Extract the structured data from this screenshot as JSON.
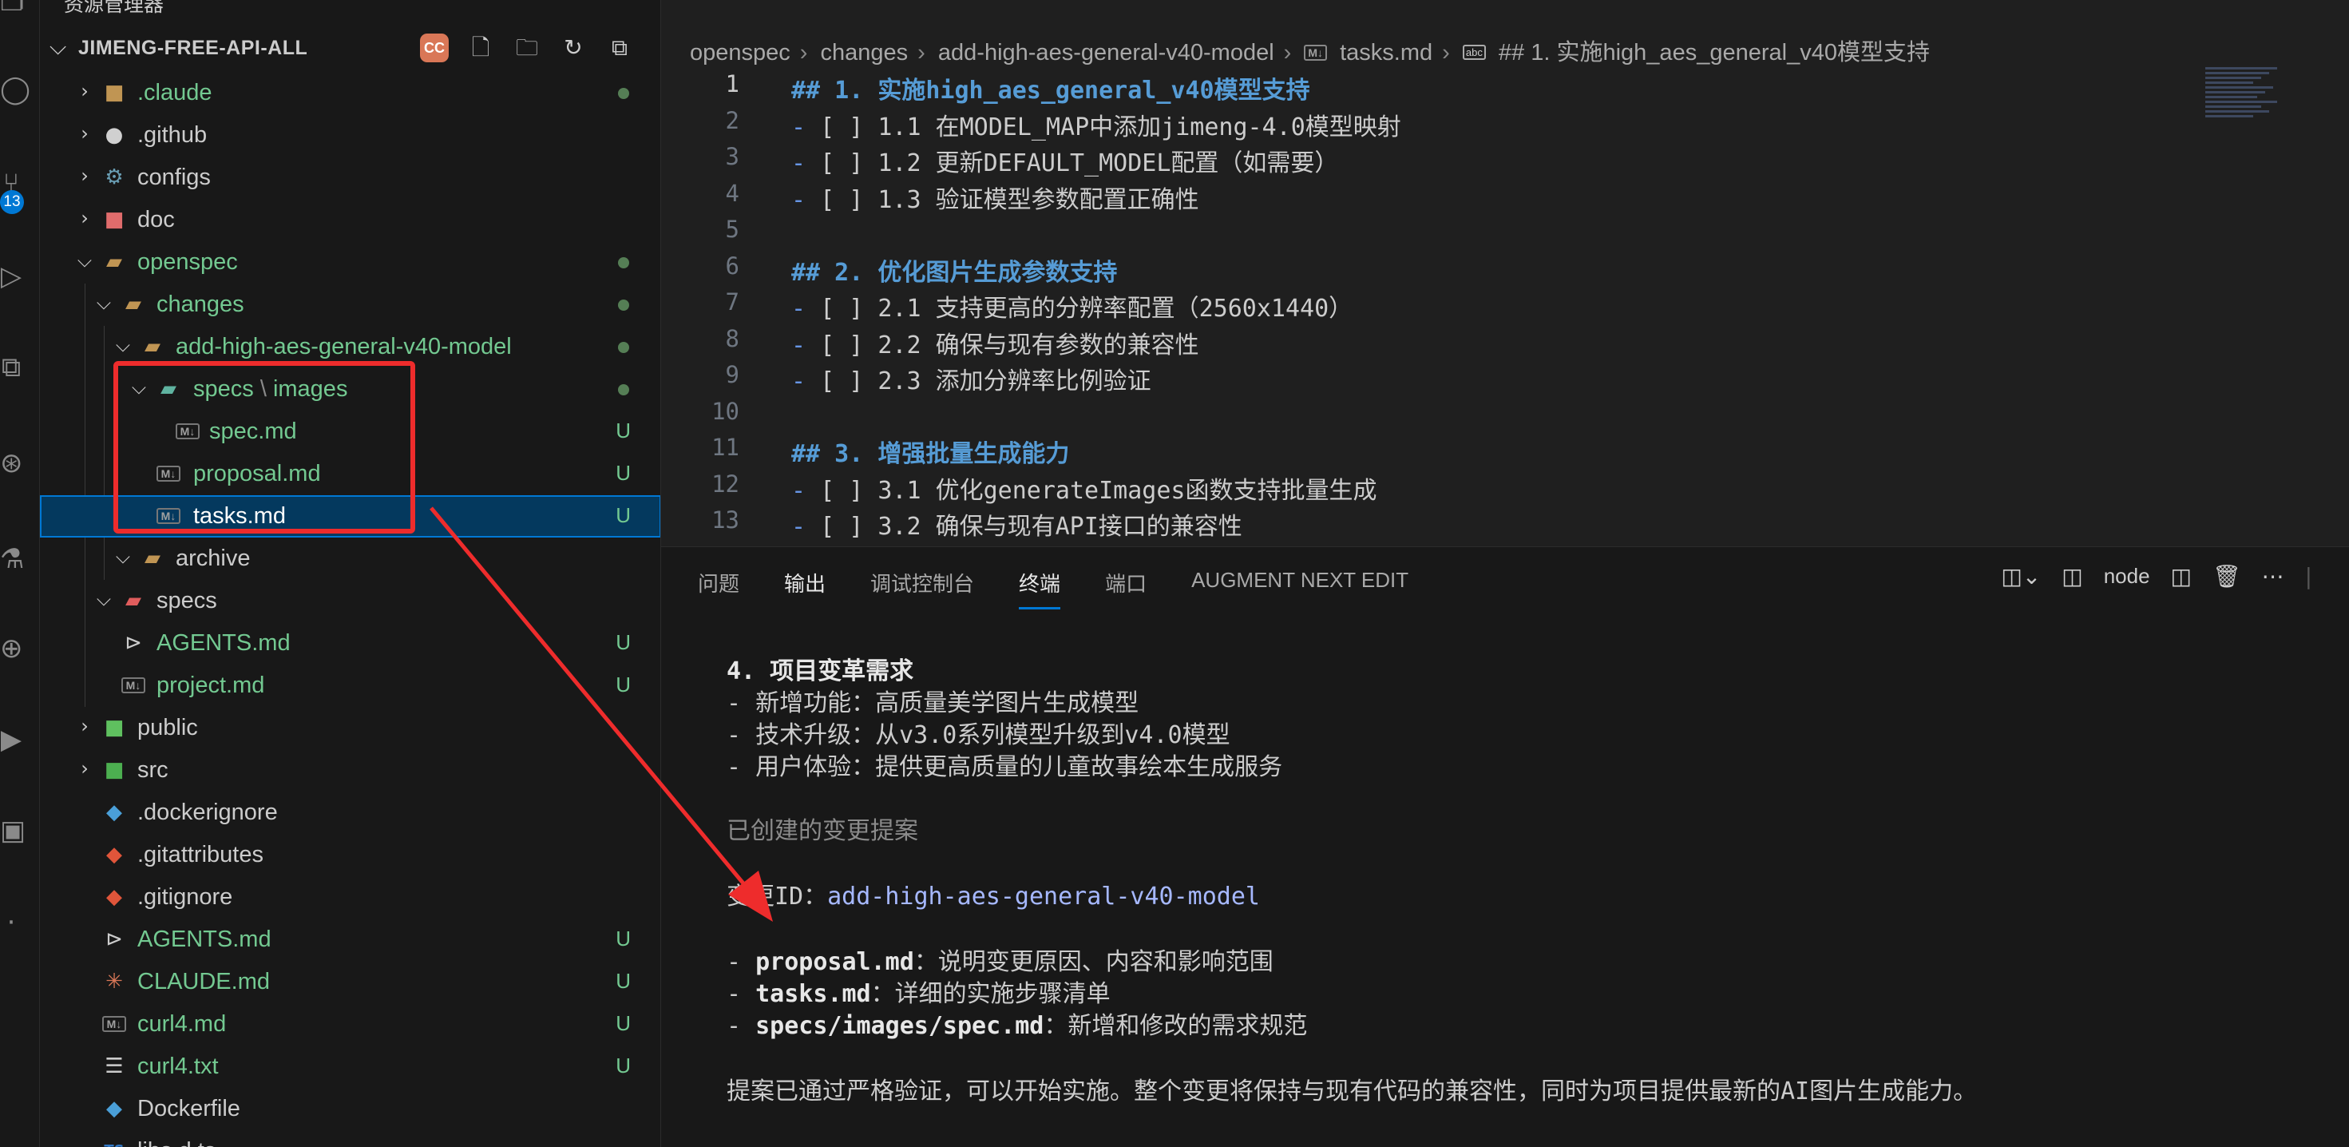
{
  "explorer": {
    "title": "资源管理器",
    "root_name": "JIMENG-FREE-API-ALL",
    "root_actions": {
      "claude_badge": "CC"
    },
    "items": [
      {
        "name": ".claude",
        "status": "dot"
      },
      {
        "name": ".github",
        "status": ""
      },
      {
        "name": "configs",
        "status": ""
      },
      {
        "name": "doc",
        "status": ""
      },
      {
        "name": "openspec",
        "status": "dot"
      },
      {
        "name": "changes",
        "status": "dot"
      },
      {
        "name": "add-high-aes-general-v40-model",
        "status": "dot"
      },
      {
        "name": "specs",
        "sep": "\\",
        "name2": "images",
        "status": "dot"
      },
      {
        "name": "spec.md",
        "status": "U"
      },
      {
        "name": "proposal.md",
        "status": "U"
      },
      {
        "name": "tasks.md",
        "status": "U"
      },
      {
        "name": "archive",
        "status": ""
      },
      {
        "name": "specs",
        "status": ""
      },
      {
        "name": "AGENTS.md",
        "status": "U"
      },
      {
        "name": "project.md",
        "status": "U"
      },
      {
        "name": "public",
        "status": ""
      },
      {
        "name": "src",
        "status": ""
      },
      {
        "name": ".dockerignore",
        "status": ""
      },
      {
        "name": ".gitattributes",
        "status": ""
      },
      {
        "name": ".gitignore",
        "status": ""
      },
      {
        "name": "AGENTS.md",
        "status": "U"
      },
      {
        "name": "CLAUDE.md",
        "status": "U"
      },
      {
        "name": "curl4.md",
        "status": "U"
      },
      {
        "name": "curl4.txt",
        "status": "U"
      },
      {
        "name": "Dockerfile",
        "status": ""
      },
      {
        "name": "libs.d.ts",
        "status": ""
      }
    ]
  },
  "activity_bar": {
    "badge_count": "13"
  },
  "breadcrumb": {
    "parts": [
      "openspec",
      "changes",
      "add-high-aes-general-v40-model",
      "tasks.md",
      "## 1. 实施high_aes_general_v40模型支持"
    ],
    "md_icon": "M↓",
    "abc_icon": "abc"
  },
  "editor": {
    "lines": [
      {
        "n": "1",
        "heading": "## 1. 实施high_aes_general_v40模型支持"
      },
      {
        "n": "2",
        "text": "1.1 在MODEL_MAP中添加jimeng-4.0模型映射"
      },
      {
        "n": "3",
        "text": "1.2 更新DEFAULT_MODEL配置（如需要）"
      },
      {
        "n": "4",
        "text": "1.3 验证模型参数配置正确性"
      },
      {
        "n": "5"
      },
      {
        "n": "6",
        "heading": "## 2. 优化图片生成参数支持"
      },
      {
        "n": "7",
        "text": "2.1 支持更高的分辨率配置（2560x1440）"
      },
      {
        "n": "8",
        "text": "2.2 确保与现有参数的兼容性"
      },
      {
        "n": "9",
        "text": "2.3 添加分辨率比例验证"
      },
      {
        "n": "10"
      },
      {
        "n": "11",
        "heading": "## 3. 增强批量生成能力"
      },
      {
        "n": "12",
        "text": "3.1 优化generateImages函数支持批量生成"
      },
      {
        "n": "13",
        "text": "3.2 确保与现有API接口的兼容性"
      }
    ],
    "bullet": "-",
    "checkbox": "[ ]"
  },
  "panel": {
    "tabs": [
      "问题",
      "输出",
      "调试控制台",
      "终端",
      "端口",
      "AUGMENT NEXT EDIT"
    ],
    "active_tab": "终端",
    "terminal_name": "node"
  },
  "terminal": {
    "heading": "4. 项目变革需求",
    "req_lines": [
      "- 新增功能：高质量美学图片生成模型",
      "- 技术升级：从v3.0系列模型升级到v4.0模型",
      "- 用户体验：提供更高质量的儿童故事绘本生成服务"
    ],
    "created_title": "已创建的变更提案",
    "change_id_label": "变更ID：",
    "change_id": "add-high-aes-general-v40-model",
    "files": [
      {
        "name": "proposal.md",
        "desc": "：说明变更原因、内容和影响范围"
      },
      {
        "name": "tasks.md",
        "desc": "：详细的实施步骤清单"
      },
      {
        "name": "specs/images/spec.md",
        "desc": "：新增和修改的需求规范"
      }
    ],
    "conclusion": "提案已通过严格验证，可以开始实施。整个变更将保持与现有代码的兼容性，同时为项目提供最新的AI图片生成能力。"
  }
}
